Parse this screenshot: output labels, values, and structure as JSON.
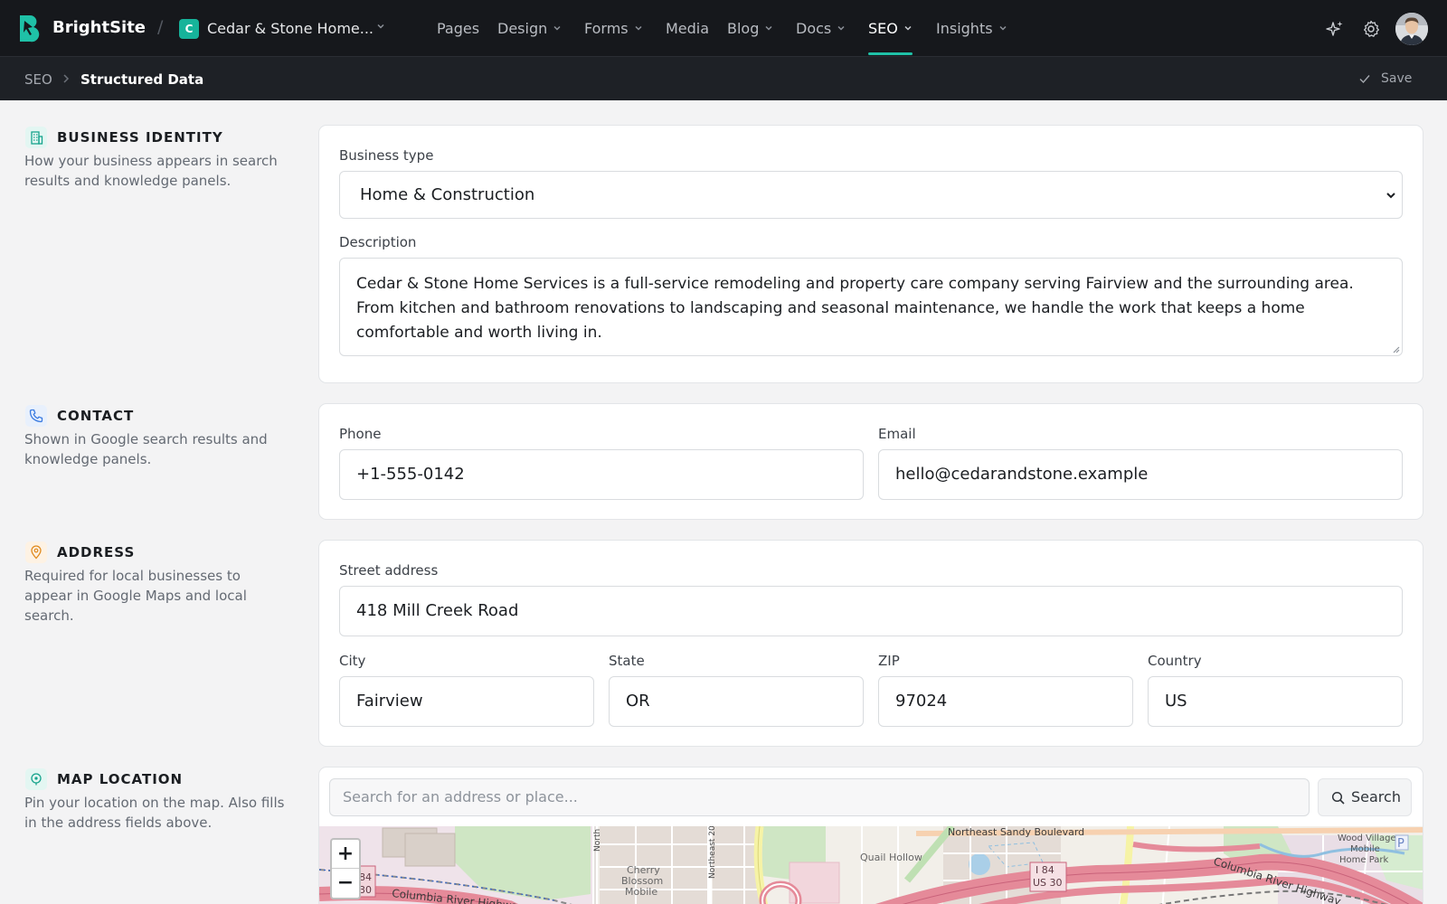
{
  "app": {
    "brand": "BrightSite",
    "site_initial": "C",
    "site_name": "Cedar & Stone Home...",
    "accent_color": "#1fc1a7"
  },
  "nav": {
    "items": [
      {
        "label": "Pages",
        "has_dropdown": false,
        "active": false
      },
      {
        "label": "Design",
        "has_dropdown": true,
        "active": false
      },
      {
        "label": "Forms",
        "has_dropdown": true,
        "active": false
      },
      {
        "label": "Media",
        "has_dropdown": false,
        "active": false
      },
      {
        "label": "Blog",
        "has_dropdown": true,
        "active": false
      },
      {
        "label": "Docs",
        "has_dropdown": true,
        "active": false
      },
      {
        "label": "SEO",
        "has_dropdown": true,
        "active": true
      },
      {
        "label": "Insights",
        "has_dropdown": true,
        "active": false
      }
    ],
    "right_icons": [
      "sparkle-icon",
      "gear-icon",
      "avatar"
    ]
  },
  "breadcrumb": {
    "root": "SEO",
    "current": "Structured Data",
    "save_label": "Save"
  },
  "sections": {
    "identity": {
      "title": "BUSINESS IDENTITY",
      "description": "How your business appears in search results and knowledge panels.",
      "icon": "building-icon",
      "business_type_label": "Business type",
      "business_type_value": "Home & Construction",
      "description_label": "Description",
      "description_value": "Cedar & Stone Home Services is a full-service remodeling and property care company serving Fairview and the surrounding area. From kitchen and bathroom renovations to landscaping and seasonal maintenance, we handle the work that keeps a home comfortable and worth living in."
    },
    "contact": {
      "title": "CONTACT",
      "description": "Shown in Google search results and knowledge panels.",
      "icon": "phone-icon",
      "phone_label": "Phone",
      "phone_value": "+1-555-0142",
      "email_label": "Email",
      "email_value": "hello@cedarandstone.example"
    },
    "address": {
      "title": "ADDRESS",
      "description": "Required for local businesses to appear in Google Maps and local search.",
      "icon": "pin-icon",
      "street_label": "Street address",
      "street_value": "418 Mill Creek Road",
      "city_label": "City",
      "city_value": "Fairview",
      "state_label": "State",
      "state_value": "OR",
      "zip_label": "ZIP",
      "zip_value": "97024",
      "country_label": "Country",
      "country_value": "US"
    },
    "map": {
      "title": "MAP LOCATION",
      "description": "Pin your location on the map. Also fills in the address fields above.",
      "icon": "map-pin-icon",
      "search_placeholder": "Search for an address or place...",
      "search_button": "Search",
      "zoom_in": "+",
      "zoom_out": "−",
      "labels": {
        "blvd": "Northeast Sandy Boulevard",
        "hwy_left": "Columbia River Highway",
        "hwy_right": "Columbia River Highway",
        "shield_left_1": "84",
        "shield_left_2": "30",
        "shield_mid_1": "I 84",
        "shield_mid_2": "US 30",
        "area_cherry_1": "Cherry",
        "area_cherry_2": "Blossom",
        "area_cherry_3": "Mobile",
        "area_quail": "Quail Hollow",
        "area_wood_1": "Wood Village",
        "area_wood_2": "Mobile",
        "area_wood_3": "Home Park",
        "road_north": "North",
        "road_ne": "Northeast 20",
        "road_p": "P"
      }
    }
  }
}
